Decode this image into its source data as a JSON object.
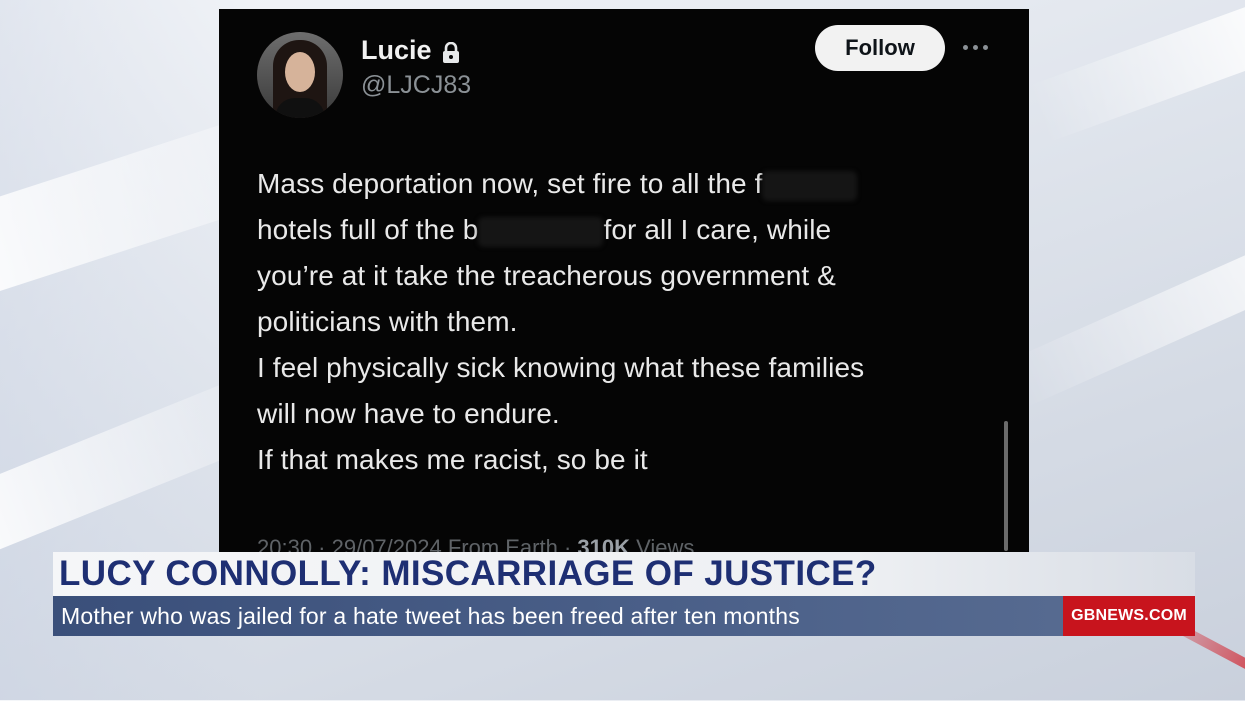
{
  "tweet": {
    "name": "Lucie",
    "handle": "@LJCJ83",
    "follow_label": "Follow",
    "lines": {
      "l1": "Mass deportation now, set fire to all the f",
      "l2a": "hotels full of the b",
      "l2b": "for all I care, while",
      "l3": "you’re at it take the treacherous government &",
      "l4": "politicians with them.",
      "l5": "I feel physically sick knowing what these families",
      "l6": "will now have to endure.",
      "l7": "If that makes me racist, so be it"
    },
    "meta_prefix": "20:30 · 29/07/2024 From Earth · ",
    "views_count": "310K",
    "views_label": " Views"
  },
  "lower_third": {
    "headline": "LUCY CONNOLLY: MISCARRIAGE OF JUSTICE?",
    "subline": "Mother who was jailed for a hate tweet has been freed after ten months",
    "channel": "GBNEWS.COM"
  },
  "colors": {
    "headline_text": "#1e2f73",
    "sub_bar": "#4a5f88",
    "channel_red": "#c8141d"
  },
  "icons": [
    "lock-icon",
    "more-icon"
  ]
}
